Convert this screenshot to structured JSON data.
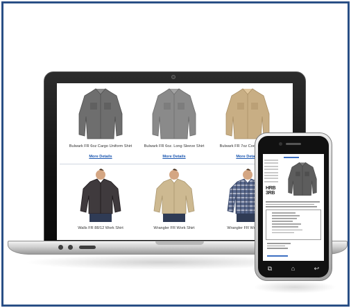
{
  "products": [
    {
      "name": "Bulwark FR 6oz Cargo Uniform Shirt",
      "link": "More Details",
      "style": "grey-hanger",
      "color": "#6e6e6e"
    },
    {
      "name": "Bulwark FR 6oz. Long Sleeve Shirt",
      "link": "More Details",
      "style": "grey-hanger",
      "color": "#8a8a8a"
    },
    {
      "name": "Bulwark FR 7oz Cooltouch Work",
      "link": "More Details",
      "style": "khaki-hanger",
      "color": "#c8ae84"
    },
    {
      "name": "Walls FR 88/12 Work Shirt",
      "link": "",
      "style": "dark-model",
      "color": "#3f3a3d"
    },
    {
      "name": "Wrangler FR Work Shirt",
      "link": "",
      "style": "khaki-model",
      "color": "#cdb991"
    },
    {
      "name": "Wrangler FR Work Shirt",
      "link": "",
      "style": "plaid-model",
      "color": "#5a6a8e"
    }
  ],
  "phone": {
    "logo": "HRB\n3RB",
    "nav_icons": [
      "recent-apps-icon",
      "home-icon",
      "back-icon"
    ],
    "nav_glyphs": [
      "⧉",
      "⌂",
      "↩"
    ],
    "shirt_color": "#5d5d5d"
  },
  "colors": {
    "frame": "#2a4f86",
    "link": "#1a56b0"
  }
}
